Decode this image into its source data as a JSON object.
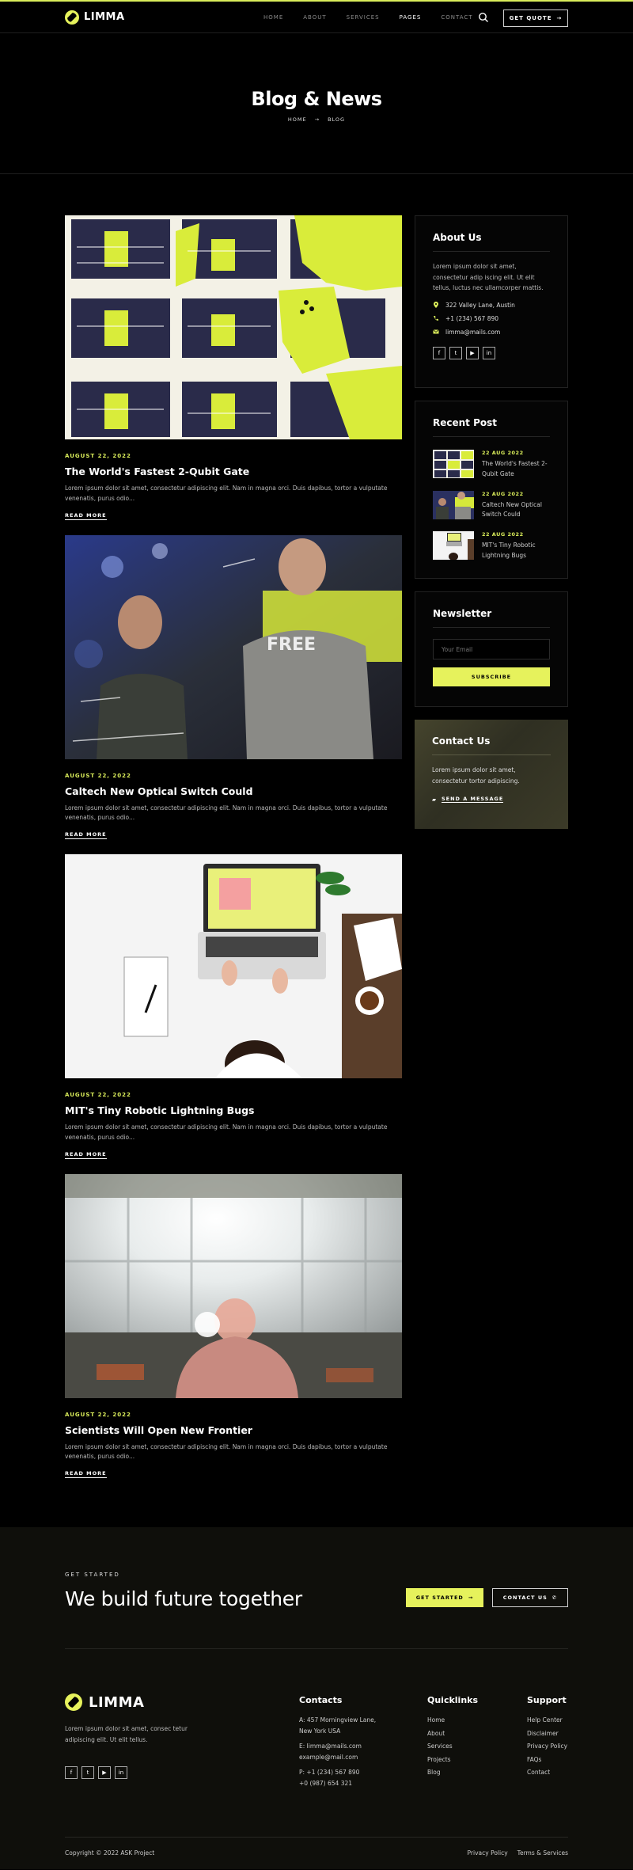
{
  "brand": {
    "name": "LIMMA",
    "accent": "#e6f25c"
  },
  "nav": {
    "items": [
      {
        "label": "HOME"
      },
      {
        "label": "ABOUT"
      },
      {
        "label": "SERVICES"
      },
      {
        "label": "PAGES"
      },
      {
        "label": "CONTACT"
      }
    ],
    "active": "PAGES",
    "quote_label": "GET QUOTE"
  },
  "hero": {
    "title": "Blog & News",
    "crumb_home": "HOME",
    "crumb_current": "BLOG"
  },
  "posts": [
    {
      "date": "AUGUST 22, 2022",
      "title": "The World's Fastest 2-Qubit Gate",
      "excerpt": "Lorem ipsum dolor sit amet, consectetur adipiscing elit. Nam in magna orci. Duis dapibus, tortor a vulputate venenatis, purus odio...",
      "read_more": "READ MORE"
    },
    {
      "date": "AUGUST 22, 2022",
      "title": "Caltech New Optical Switch Could",
      "excerpt": "Lorem ipsum dolor sit amet, consectetur adipiscing elit. Nam in magna orci. Duis dapibus, tortor a vulputate venenatis, purus odio...",
      "read_more": "READ MORE"
    },
    {
      "date": "AUGUST 22, 2022",
      "title": "MIT's Tiny Robotic Lightning Bugs",
      "excerpt": "Lorem ipsum dolor sit amet, consectetur adipiscing elit. Nam in magna orci. Duis dapibus, tortor a vulputate venenatis, purus odio...",
      "read_more": "READ MORE"
    },
    {
      "date": "AUGUST 22, 2022",
      "title": "Scientists Will Open New Frontier",
      "excerpt": "Lorem ipsum dolor sit amet, consectetur adipiscing elit. Nam in magna orci. Duis dapibus, tortor a vulputate venenatis, purus odio...",
      "read_more": "READ MORE"
    }
  ],
  "sidebar": {
    "about": {
      "title": "About Us",
      "text": "Lorem ipsum dolor sit amet, consectetur adip iscing elit. Ut elit tellus, luctus nec ullamcorper mattis.",
      "address": "322 Valley Lane, Austin",
      "phone": "+1 (234) 567 890",
      "email": "limma@mails.com"
    },
    "recent": {
      "title": "Recent Post",
      "items": [
        {
          "date": "22 AUG 2022",
          "title": "The World's Fastest 2-Qubit Gate"
        },
        {
          "date": "22 AUG 2022",
          "title": "Caltech New Optical Switch Could"
        },
        {
          "date": "22 AUG 2022",
          "title": "MIT's Tiny Robotic Lightning Bugs"
        }
      ]
    },
    "newsletter": {
      "title": "Newsletter",
      "placeholder": "Your Email",
      "button": "SUBSCRIBE"
    },
    "contact": {
      "title": "Contact Us",
      "text": "Lorem ipsum dolor sit amet, consectetur tortor adipiscing.",
      "link": "SEND A MESSAGE"
    }
  },
  "cta": {
    "kicker": "GET STARTED",
    "title": "We build future together",
    "start_label": "GET STARTED",
    "contact_label": "CONTACT US"
  },
  "footer": {
    "brand": "LIMMA",
    "desc": "Lorem ipsum dolor sit amet, consec tetur adipiscing elit. Ut elit tellus.",
    "contacts": {
      "title": "Contacts",
      "address1": "A: 457 Morningview Lane,",
      "address2": "New York USA",
      "email1": "E: limma@mails.com",
      "email2": "example@mail.com",
      "phone1": "P: +1 (234) 567 890",
      "phone2": "+0 (987) 654 321"
    },
    "quicklinks": {
      "title": "Quicklinks",
      "items": [
        "Home",
        "About",
        "Services",
        "Projects",
        "Blog"
      ]
    },
    "support": {
      "title": "Support",
      "items": [
        "Help Center",
        "Disclaimer",
        "Privacy Policy",
        "FAQs",
        "Contact"
      ]
    },
    "copyright": "Copyright © 2022 ASK Project",
    "links": [
      "Privacy Policy",
      "Terms & Services"
    ]
  }
}
